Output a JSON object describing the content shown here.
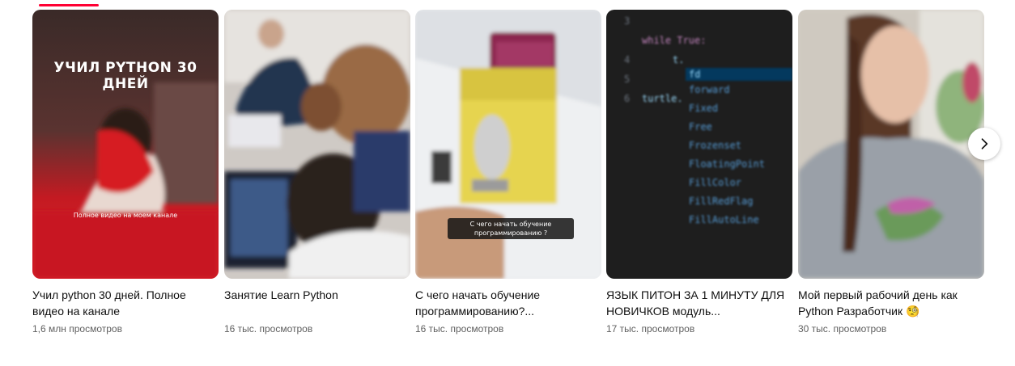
{
  "cards": [
    {
      "title": "Учил python 30 дней. Полное видео на канале",
      "views": "1,6 млн просмотров",
      "overlay_top": "УЧИЛ PYTHON 30 ДНЕЙ",
      "overlay_bottom": "Полное видео на моем канале"
    },
    {
      "title": "Занятие Learn Python",
      "views": "16 тыс. просмотров"
    },
    {
      "title": "С чего начать обучение программированию?...",
      "views": "16 тыс. просмотров",
      "overlay_caption": "С чего начать обучение программированию ?"
    },
    {
      "title": "ЯЗЫК ПИТОН ЗА 1 МИНУТУ ДЛЯ НОВИЧКОВ модуль...",
      "views": "17 тыс. просмотров",
      "code": {
        "line_numbers": [
          "3",
          "4",
          "5",
          "6"
        ],
        "line1": "while True:",
        "line2": "t.",
        "line3": "turtle.",
        "suggestions": [
          "fd",
          "forward",
          "Fixed",
          "Free",
          "Frozenset",
          "FloatingPoint",
          "FillColor",
          "FillRedFlag",
          "FillAutoLine"
        ]
      }
    },
    {
      "title": "Мой первый рабочий день как Python Разработчик 🧐",
      "views": "30 тыс. просмотров"
    }
  ],
  "colors": {
    "accent": "#ff0033",
    "title": "#0f0f0f",
    "meta": "#606060"
  },
  "icons": {
    "next": "chevron-right-icon"
  }
}
